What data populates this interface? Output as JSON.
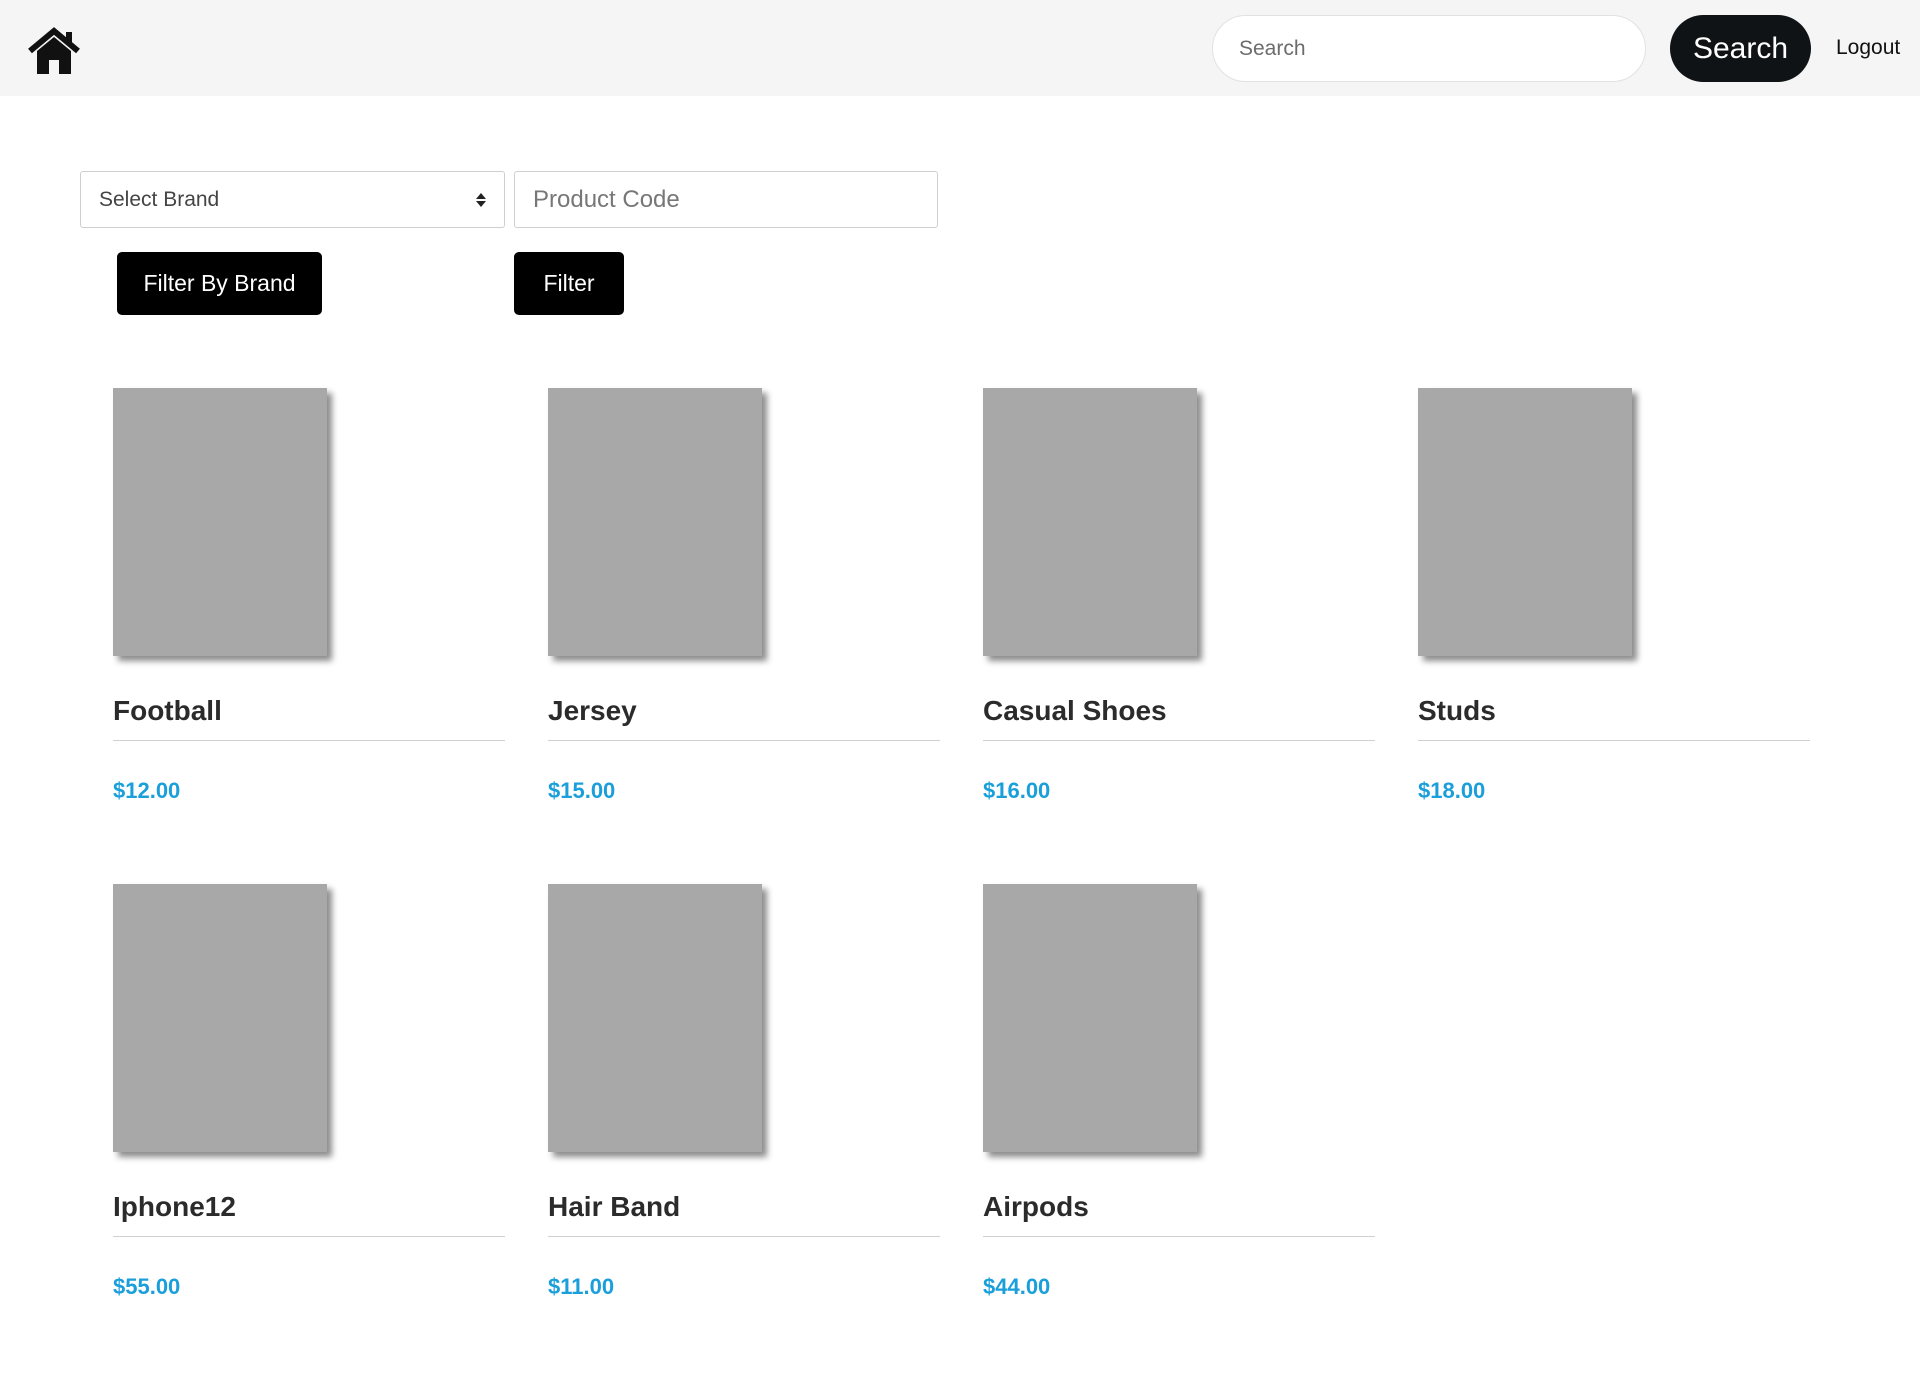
{
  "navbar": {
    "home_icon": "home-icon",
    "search": {
      "placeholder": "Search",
      "value": ""
    },
    "search_button_label": "Search",
    "logout_label": "Logout"
  },
  "filters": {
    "brand_select": {
      "selected": "Select Brand",
      "icon": "sort-arrows-icon"
    },
    "product_code": {
      "placeholder": "Product Code",
      "value": ""
    },
    "filter_by_brand_label": "Filter By Brand",
    "filter_label": "Filter"
  },
  "colors": {
    "price": "#1a9fdb",
    "button_bg": "#000000",
    "search_button_bg": "#101315",
    "image_placeholder": "#a8a8a8",
    "navbar_bg": "#f5f5f5"
  },
  "products": [
    {
      "name": "Football",
      "price": "$12.00"
    },
    {
      "name": "Jersey",
      "price": "$15.00"
    },
    {
      "name": "Casual Shoes",
      "price": "$16.00"
    },
    {
      "name": "Studs",
      "price": "$18.00"
    },
    {
      "name": "Iphone12",
      "price": "$55.00"
    },
    {
      "name": "Hair Band",
      "price": "$11.00"
    },
    {
      "name": "Airpods",
      "price": "$44.00"
    }
  ]
}
